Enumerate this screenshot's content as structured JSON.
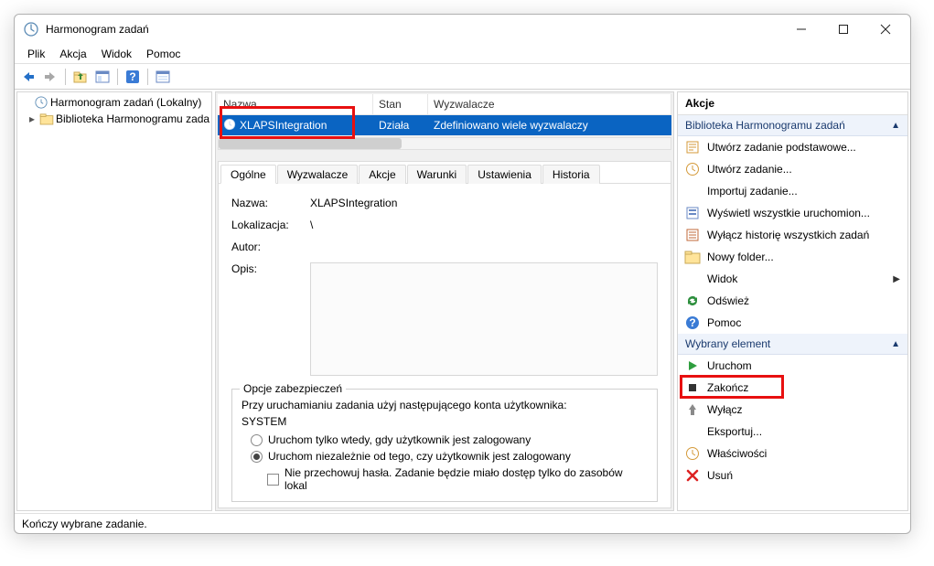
{
  "window": {
    "title": "Harmonogram zadań"
  },
  "menu": {
    "file": "Plik",
    "action": "Akcja",
    "view": "Widok",
    "help": "Pomoc"
  },
  "tree": {
    "root": "Harmonogram zadań (Lokalny)",
    "library": "Biblioteka Harmonogramu zada"
  },
  "tasklist": {
    "col_name": "Nazwa",
    "col_state": "Stan",
    "col_triggers": "Wyzwalacze",
    "row": {
      "name": "XLAPSIntegration",
      "state": "Działa",
      "triggers": "Zdefiniowano wiele wyzwalaczy"
    }
  },
  "tabs": {
    "general": "Ogólne",
    "triggers": "Wyzwalacze",
    "actions": "Akcje",
    "conditions": "Warunki",
    "settings": "Ustawienia",
    "history": "Historia"
  },
  "general": {
    "name_label": "Nazwa:",
    "name_value": "XLAPSIntegration",
    "location_label": "Lokalizacja:",
    "location_value": "\\",
    "author_label": "Autor:",
    "author_value": "",
    "desc_label": "Opis:",
    "security_legend": "Opcje zabezpieczeń",
    "security_text": "Przy uruchamianiu zadania użyj następującego konta użytkownika:",
    "security_user": "SYSTEM",
    "radio_logged": "Uruchom tylko wtedy, gdy użytkownik jest zalogowany",
    "radio_always": "Uruchom niezależnie od tego, czy użytkownik jest zalogowany",
    "check_nopass": "Nie przechowuj hasła. Zadanie będzie miało dostęp tylko do zasobów lokal"
  },
  "actionspane": {
    "title": "Akcje",
    "sec1": "Biblioteka Harmonogramu zadań",
    "create_basic": "Utwórz zadanie podstawowe...",
    "create": "Utwórz zadanie...",
    "import": "Importuj zadanie...",
    "show_running": "Wyświetl wszystkie uruchomion...",
    "disable_history": "Wyłącz historię wszystkich zadań",
    "new_folder": "Nowy folder...",
    "view": "Widok",
    "refresh": "Odśwież",
    "help": "Pomoc",
    "sec2": "Wybrany element",
    "run": "Uruchom",
    "end": "Zakończ",
    "disable": "Wyłącz",
    "export": "Eksportuj...",
    "properties": "Właściwości",
    "delete": "Usuń"
  },
  "statusbar": "Kończy wybrane zadanie."
}
